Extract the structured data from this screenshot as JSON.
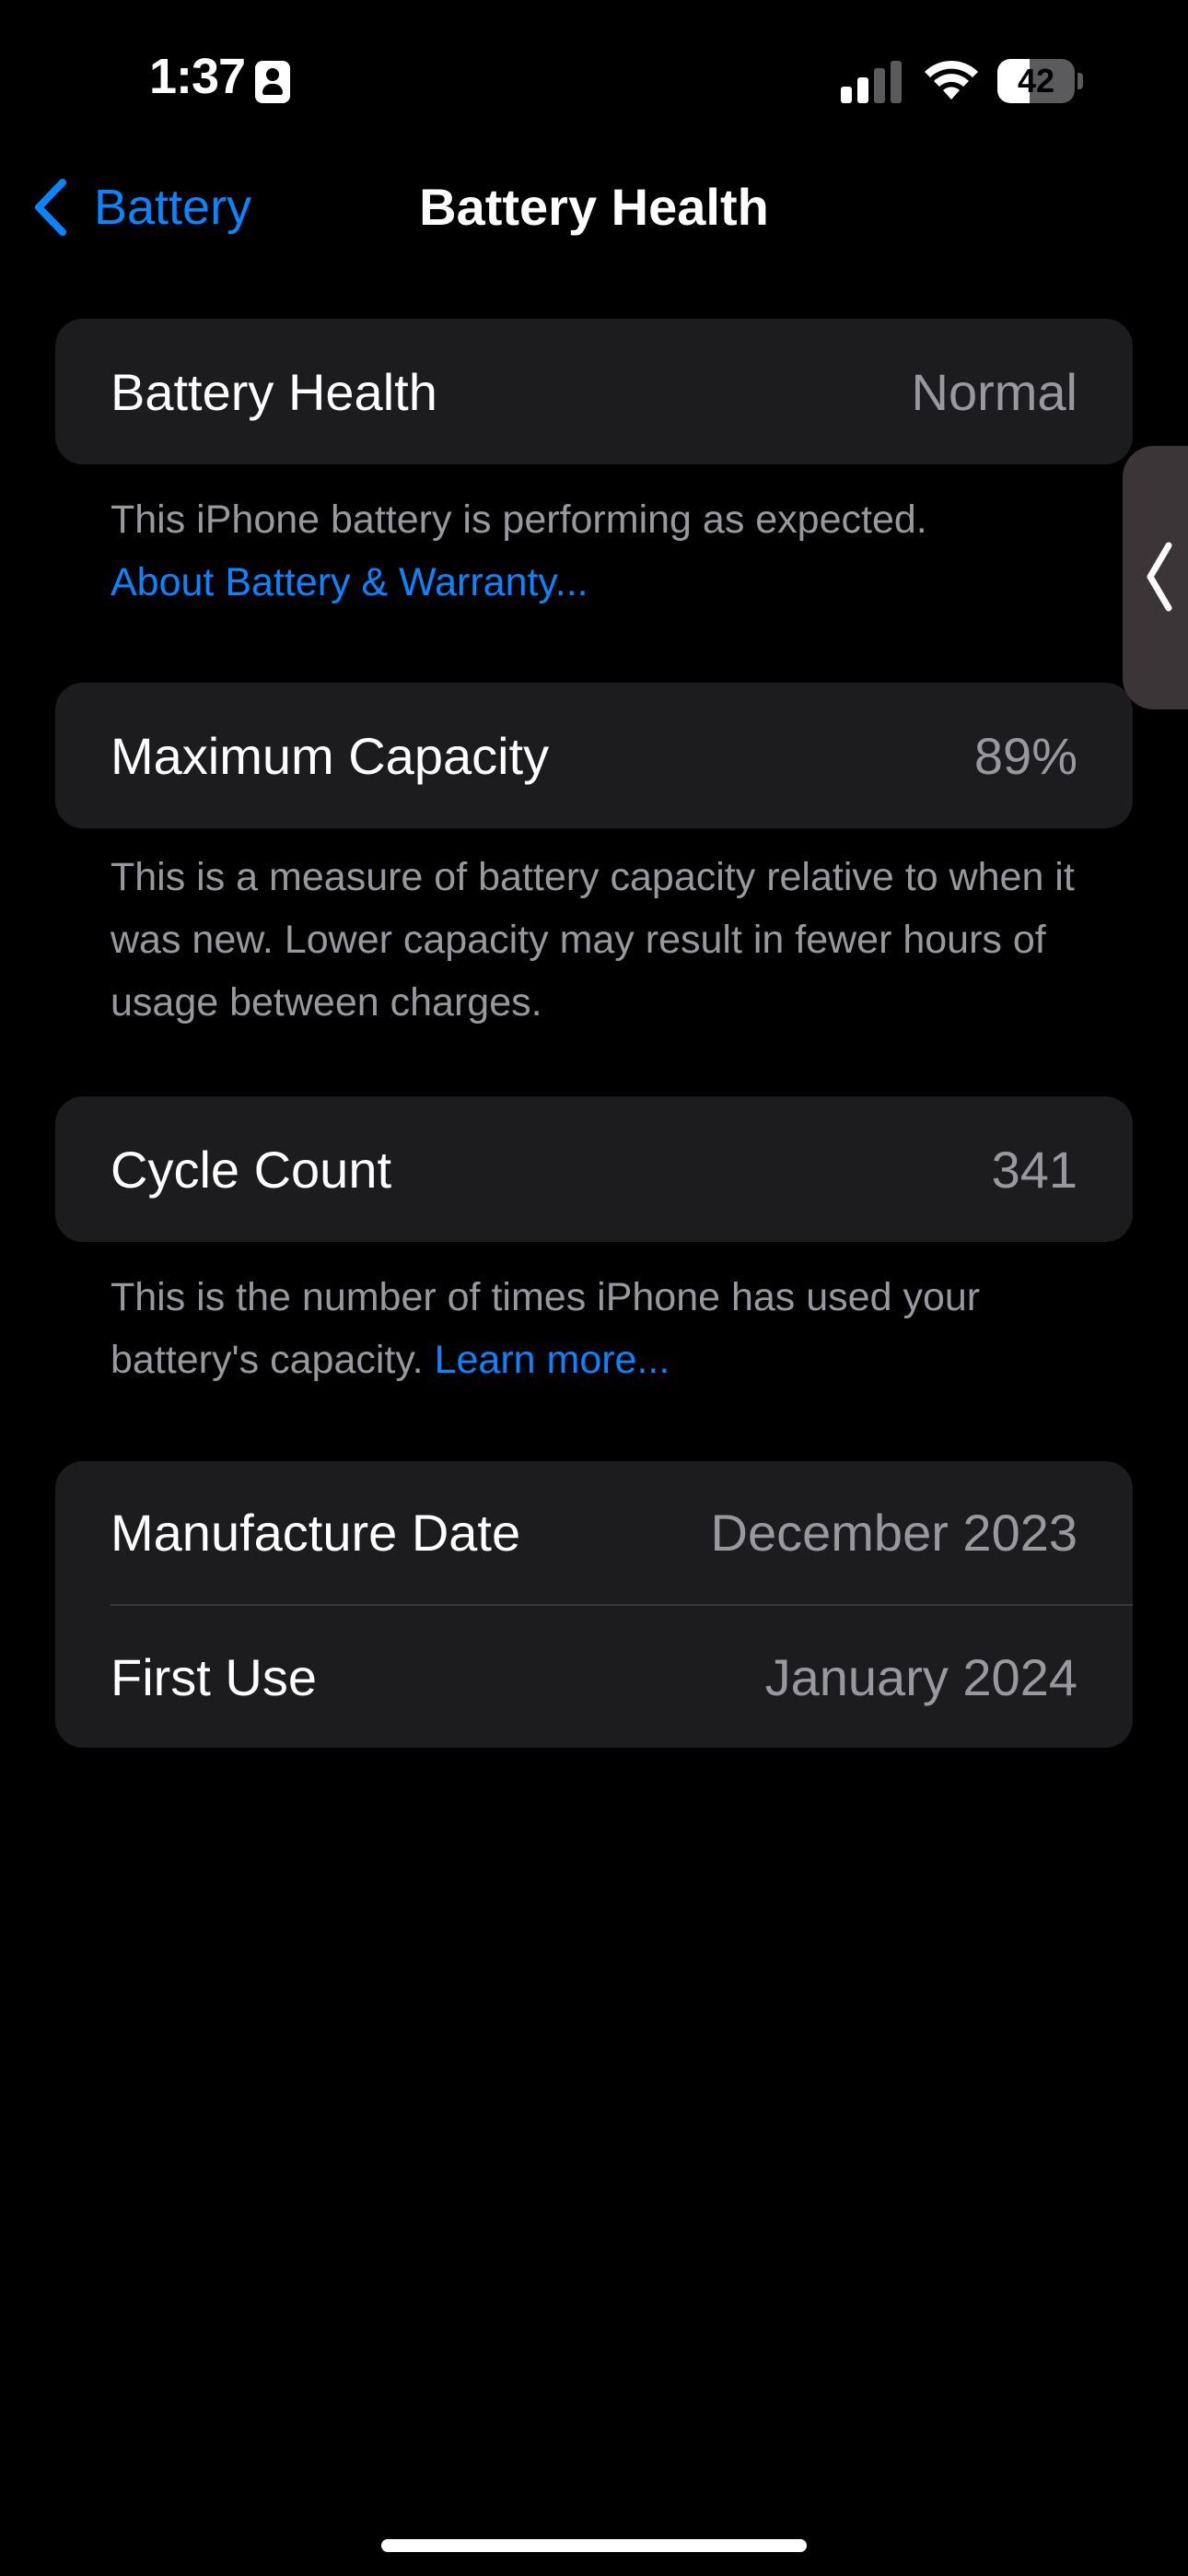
{
  "status_bar": {
    "time": "1:37",
    "battery_level": "42",
    "battery_fraction": 0.42,
    "icons": [
      "contact-card-icon",
      "cellular-signal-icon",
      "wifi-icon",
      "battery-icon"
    ]
  },
  "nav": {
    "back_label": "Battery",
    "title": "Battery Health"
  },
  "sections": {
    "health": {
      "label": "Battery Health",
      "value": "Normal",
      "footnote": "This iPhone battery is performing as expected.",
      "link": "About Battery & Warranty..."
    },
    "capacity": {
      "label": "Maximum Capacity",
      "value": "89%",
      "footnote": "This is a measure of battery capacity relative to when it was new. Lower capacity may result in fewer hours of usage between charges."
    },
    "cycle": {
      "label": "Cycle Count",
      "value": "341",
      "footnote": "This is the number of times iPhone has used your battery's capacity.",
      "link": "Learn more..."
    },
    "dates": {
      "manufacture_label": "Manufacture Date",
      "manufacture_value": "December 2023",
      "first_use_label": "First Use",
      "first_use_value": "January 2024"
    }
  },
  "colors": {
    "background": "#000000",
    "card": "#1c1c1e",
    "accent": "#0a84ff",
    "secondary_text": "#98989f"
  }
}
